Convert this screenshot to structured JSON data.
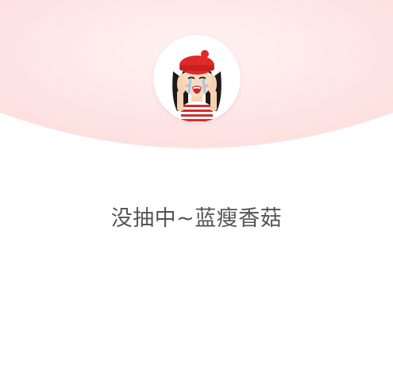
{
  "result": {
    "message": "没抽中~蓝瘦香菇"
  },
  "avatar": {
    "icon": "crying-girl-icon"
  },
  "colors": {
    "header_background": "#fde3e3",
    "header_glow": "#fff1f1",
    "text": "#555555",
    "hat": "#e02a2a",
    "stripes": "#d92b2b"
  }
}
